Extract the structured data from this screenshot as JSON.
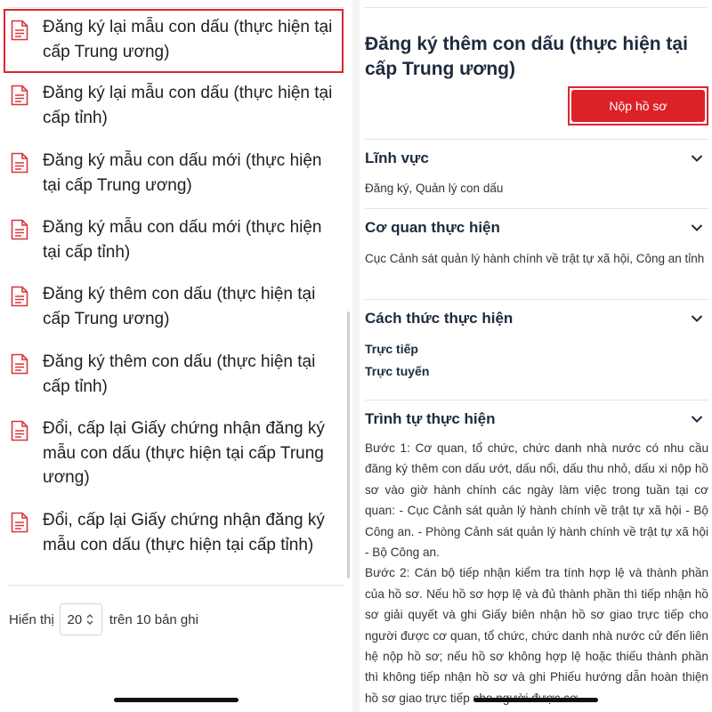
{
  "procedures": [
    {
      "label": "Đăng ký lại mẫu con dấu (thực hiện tại cấp Trung ương)",
      "selected": true
    },
    {
      "label": "Đăng ký lại mẫu con dấu (thực hiện tại cấp tỉnh)"
    },
    {
      "label": "Đăng ký mẫu con dấu mới (thực hiện tại cấp Trung ương)"
    },
    {
      "label": "Đăng ký mẫu con dấu mới (thực hiện tại cấp tỉnh)"
    },
    {
      "label": "Đăng ký thêm con dấu (thực hiện tại cấp Trung ương)"
    },
    {
      "label": "Đăng ký thêm con dấu (thực hiện tại cấp tỉnh)"
    },
    {
      "label": "Đổi, cấp lại Giấy chứng nhận đăng ký mẫu con dấu (thực hiện tại cấp Trung ương)"
    },
    {
      "label": "Đổi, cấp lại Giấy chứng nhận đăng ký mẫu con dấu (thực hiện tại cấp tỉnh)"
    }
  ],
  "pager": {
    "show_label": "Hiển thị",
    "page_size": "20",
    "total_label": "trên 10 bản ghi"
  },
  "detail": {
    "title": "Đăng ký thêm con dấu (thực hiện tại cấp Trung ương)",
    "submit_label": "Nộp hồ sơ",
    "sections": {
      "field": {
        "title": "Lĩnh vực",
        "body": "Đăng ký, Quản lý con dấu"
      },
      "agency": {
        "title": "Cơ quan thực hiện",
        "body": "Cục Cảnh sát quản lý hành chính về trật tự xã hội, Công an tỉnh"
      },
      "method": {
        "title": "Cách thức thực hiện",
        "items": [
          "Trực tiếp",
          "Trực tuyến"
        ]
      },
      "steps": {
        "title": "Trình tự thực hiện",
        "paragraphs": [
          "Bước 1: Cơ quan, tổ chức, chức danh nhà nước có nhu cầu đăng ký thêm con dấu ướt, dấu nổi, dấu thu nhỏ, dấu xi nộp hồ sơ vào giờ hành chính các ngày làm việc trong tuần tại cơ quan: - Cục Cảnh sát quản lý hành chính về trật tự xã hội - Bộ Công an. - Phòng Cảnh sát quản lý hành chính về trật tự xã hội - Bộ Công an.",
          "Bước 2: Cán bộ tiếp nhận kiểm tra tính hợp lệ và thành phần của hồ sơ. Nếu hồ sơ hợp lệ và đủ thành phần thì tiếp nhận hồ sơ giải quyết và ghi Giấy biên nhận hồ sơ giao trực tiếp cho người được cơ quan, tổ chức, chức danh nhà nước cử đến liên hệ nộp hồ sơ; nếu hồ sơ không hợp lệ hoặc thiếu thành phần thì không tiếp nhận hồ sơ và ghi Phiếu hướng dẫn hoàn thiện hồ sơ giao trực tiếp cho người được cơ"
        ]
      }
    }
  },
  "colors": {
    "accent": "#dc2127",
    "highlight_border": "#e0252d",
    "heading": "#1d2b3c",
    "icon": "#d9363e"
  }
}
